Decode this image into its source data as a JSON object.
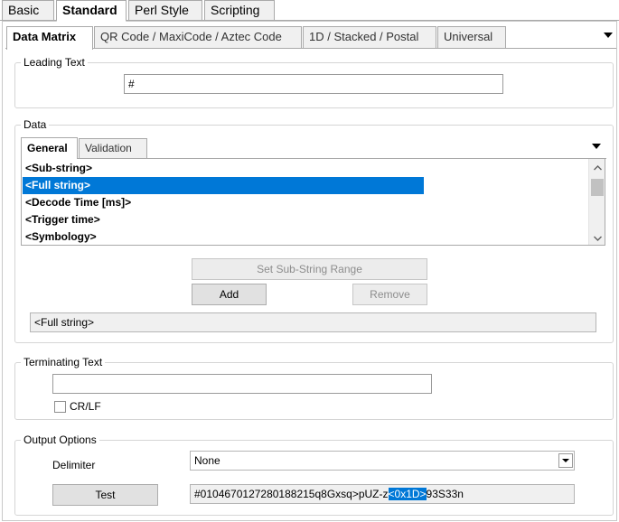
{
  "top_tabs": [
    "Basic",
    "Standard",
    "Perl Style",
    "Scripting"
  ],
  "sub_tabs": [
    "Data Matrix",
    "QR Code / MaxiCode / Aztec Code",
    "1D / Stacked / Postal",
    "Universal"
  ],
  "leading_text": {
    "title": "Leading Text",
    "value": "#"
  },
  "data": {
    "title": "Data",
    "tabs": [
      "General",
      "Validation"
    ],
    "items": [
      "<Sub-string>",
      "<Full string>",
      "<Decode Time [ms]>",
      "<Trigger time>",
      "<Symbology>"
    ],
    "selected_index": 1,
    "set_range_label": "Set Sub-String Range",
    "add_label": "Add",
    "remove_label": "Remove",
    "summary": "<Full string>"
  },
  "terminating_text": {
    "title": "Terminating Text",
    "value": "",
    "crlf_label": "CR/LF",
    "crlf_checked": false
  },
  "output_options": {
    "title": "Output Options",
    "delimiter_label": "Delimiter",
    "delimiter_value": "None",
    "test_label": "Test",
    "test_output_prefix": "#0104670127280188215q8Gxsq>pUZ-z",
    "test_output_highlight": "<0x1D>",
    "test_output_suffix": "93S33n"
  },
  "colors": {
    "selection": "#0078d7",
    "border": "#a9a9a9",
    "button_face": "#e1e1e1"
  }
}
